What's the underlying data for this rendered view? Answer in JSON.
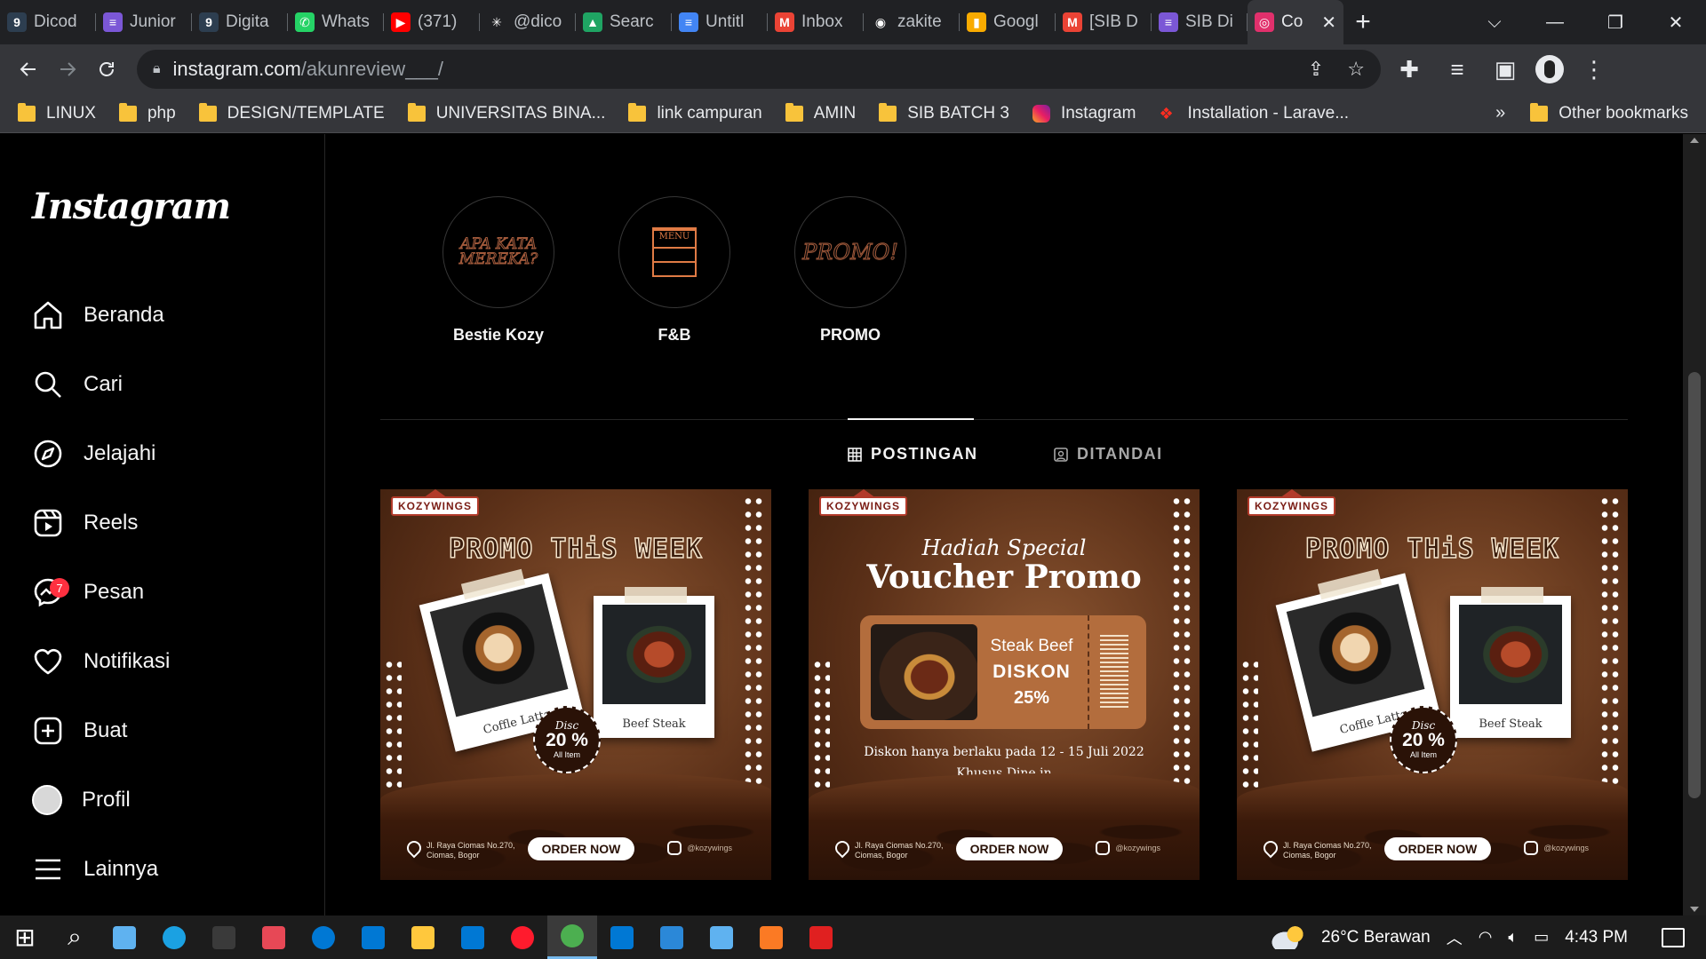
{
  "browser": {
    "tabs": [
      {
        "title": "Dicod",
        "icon": "dicoding-icon",
        "color": "#2d3e50",
        "glyph": "9"
      },
      {
        "title": "Junior",
        "icon": "list-icon",
        "color": "#7b57d6",
        "glyph": "≡"
      },
      {
        "title": "Digita",
        "icon": "dicoding-icon",
        "color": "#2d3e50",
        "glyph": "9"
      },
      {
        "title": "Whats",
        "icon": "whatsapp-icon",
        "color": "#25d366",
        "glyph": "✆"
      },
      {
        "title": "(371)",
        "icon": "youtube-icon",
        "color": "#ff0000",
        "glyph": "▶"
      },
      {
        "title": "@dico",
        "icon": "asterisk-icon",
        "color": "#202124",
        "glyph": "✳"
      },
      {
        "title": "Searc",
        "icon": "drive-icon",
        "color": "#1fa463",
        "glyph": "▲"
      },
      {
        "title": "Untitl",
        "icon": "docs-icon",
        "color": "#4285f4",
        "glyph": "≡"
      },
      {
        "title": "Inbox",
        "icon": "gmail-icon",
        "color": "#ea4335",
        "glyph": "M"
      },
      {
        "title": "zakite",
        "icon": "github-icon",
        "color": "#202124",
        "glyph": "◉"
      },
      {
        "title": "Googl",
        "icon": "google-analytics-icon",
        "color": "#f9ab00",
        "glyph": "▮"
      },
      {
        "title": "[SIB D",
        "icon": "gmail-icon",
        "color": "#ea4335",
        "glyph": "M"
      },
      {
        "title": "SIB Di",
        "icon": "list-icon",
        "color": "#7b57d6",
        "glyph": "≡"
      },
      {
        "title": "Co",
        "icon": "instagram-icon",
        "color": "#e1306c",
        "glyph": "◎",
        "active": true
      }
    ],
    "close_glyph": "✕",
    "new_tab_glyph": "+",
    "window_controls": {
      "tab_search": "⌵",
      "minimize": "—",
      "restore": "❐",
      "close": "✕"
    },
    "url_host": "instagram.com",
    "url_path": "/akunreview___/",
    "bookmarks": [
      {
        "label": "LINUX",
        "icon": "folder"
      },
      {
        "label": "php",
        "icon": "folder"
      },
      {
        "label": "DESIGN/TEMPLATE",
        "icon": "folder"
      },
      {
        "label": "UNIVERSITAS BINA...",
        "icon": "folder"
      },
      {
        "label": "link campuran",
        "icon": "folder"
      },
      {
        "label": "AMIN",
        "icon": "folder"
      },
      {
        "label": "SIB BATCH 3",
        "icon": "folder"
      },
      {
        "label": "Instagram",
        "icon": "instagram"
      },
      {
        "label": "Installation - Larave...",
        "icon": "laravel"
      }
    ],
    "bookmarks_overflow": "»",
    "other_bookmarks": "Other bookmarks"
  },
  "instagram": {
    "logo": "Instagram",
    "nav": [
      {
        "label": "Beranda",
        "icon": "home-icon"
      },
      {
        "label": "Cari",
        "icon": "search-icon"
      },
      {
        "label": "Jelajahi",
        "icon": "compass-icon"
      },
      {
        "label": "Reels",
        "icon": "reels-icon"
      },
      {
        "label": "Pesan",
        "icon": "messenger-icon",
        "badge": "7"
      },
      {
        "label": "Notifikasi",
        "icon": "heart-icon"
      },
      {
        "label": "Buat",
        "icon": "plus-square-icon"
      },
      {
        "label": "Profil",
        "icon": "profile-avatar"
      },
      {
        "label": "Lainnya",
        "icon": "menu-icon"
      }
    ],
    "highlights": [
      {
        "label": "Bestie Kozy",
        "cover_text": "APA KATA MEREKA?"
      },
      {
        "label": "F&B",
        "cover_text": "MENU"
      },
      {
        "label": "PROMO",
        "cover_text": "PROMO!"
      }
    ],
    "profile_tabs": {
      "posts": "POSTINGAN",
      "tagged": "DITANDAI"
    },
    "posts": [
      {
        "brand": "KOZYWINGS",
        "title": "PROMO THiS WEEK",
        "items": [
          "Coffle Latte",
          "Beef Steak"
        ],
        "discount": {
          "label": "Disc",
          "value": "20 %",
          "scope": "All Item"
        },
        "address": "Jl. Raya Ciomas No.270, Ciomas, Bogor",
        "cta": "ORDER NOW",
        "handle": "@kozywings"
      },
      {
        "brand": "KOZYWINGS",
        "subtitle": "Hadiah Special",
        "title": "Voucher Promo",
        "voucher": {
          "item": "Steak Beef",
          "label": "DISKON",
          "value": "25%"
        },
        "note_1": "Diskon hanya berlaku pada  12 - 15 Juli 2022",
        "note_2": "Khusus Dine in",
        "address": "Jl. Raya Ciomas No.270, Ciomas, Bogor",
        "cta": "ORDER NOW",
        "handle": "@kozywings"
      },
      {
        "brand": "KOZYWINGS",
        "title": "PROMO THiS WEEK",
        "items": [
          "Coffle Latte",
          "Beef Steak"
        ],
        "discount": {
          "label": "Disc",
          "value": "20 %",
          "scope": "All Item"
        },
        "address": "Jl. Raya Ciomas No.270, Ciomas, Bogor",
        "cta": "ORDER NOW",
        "handle": "@kozywings"
      }
    ]
  },
  "taskbar": {
    "apps": [
      {
        "name": "start-button",
        "color": "#ffffff"
      },
      {
        "name": "search-button",
        "color": "#ffffff"
      },
      {
        "name": "task-view",
        "color": "#5fb2f0"
      },
      {
        "name": "edge",
        "color": "#1ba1e2"
      },
      {
        "name": "terminal",
        "color": "#3a3a3a"
      },
      {
        "name": "gift-app",
        "color": "#e74856"
      },
      {
        "name": "app-circle",
        "color": "#0078d4"
      },
      {
        "name": "vscode",
        "color": "#0078d4"
      },
      {
        "name": "file-explorer",
        "color": "#ffc83d"
      },
      {
        "name": "store",
        "color": "#0078d4"
      },
      {
        "name": "opera",
        "color": "#ff1b2d"
      },
      {
        "name": "chrome",
        "color": "#4caf50",
        "active": true
      },
      {
        "name": "mail",
        "color": "#0078d4"
      },
      {
        "name": "arrow-app",
        "color": "#2b88d8"
      },
      {
        "name": "remote-desktop",
        "color": "#5fb2f0"
      },
      {
        "name": "xampp",
        "color": "#fb7a24"
      },
      {
        "name": "acrobat",
        "color": "#e02020"
      }
    ],
    "weather": "26°C  Berawan",
    "time": "4:43 PM"
  }
}
